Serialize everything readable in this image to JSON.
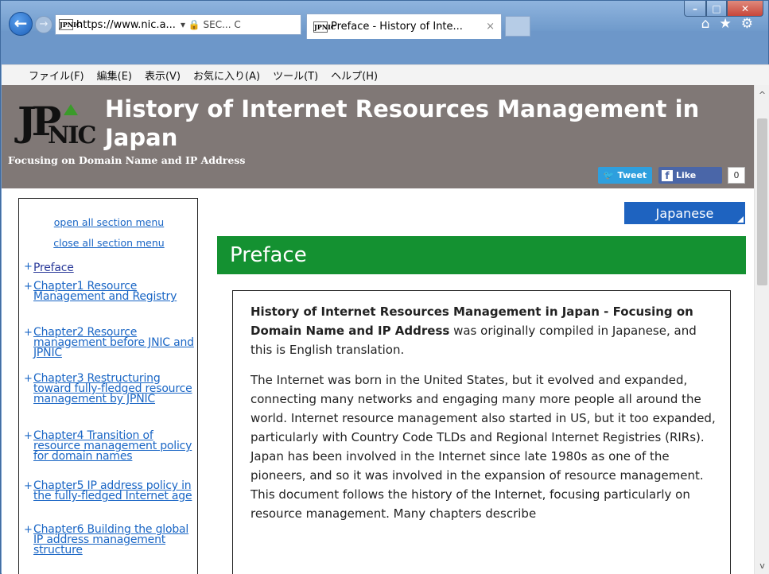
{
  "browser": {
    "window_controls": [
      "–",
      "□",
      "✕"
    ],
    "address": {
      "favicon_text": "JPNIC",
      "url": "https://www.nic.a...",
      "controls": "▾  🔒 SEC... C"
    },
    "tab": {
      "favicon_text": "JPNIC",
      "title": "Preface - History of Inte...",
      "close": "×"
    },
    "tool_icons": [
      "⌂",
      "★",
      "⚙"
    ],
    "menu": [
      "ファイル(F)",
      "編集(E)",
      "表示(V)",
      "お気に入り(A)",
      "ツール(T)",
      "ヘルプ(H)"
    ]
  },
  "banner": {
    "title": "History of Internet Resources Management in Japan",
    "subtitle": "Focusing on Domain Name and IP Address",
    "tweet_label": "Tweet",
    "like_label": "Like",
    "like_count": "0"
  },
  "sidebar": {
    "open_all": "open all section menu",
    "close_all": "close all section menu",
    "items": [
      "Preface",
      "Chapter1 Resource Management and Registry",
      "Chapter2 Resource management before JNIC and JPNIC",
      "Chapter3 Restructuring toward fully-fledged resource management by JPNIC",
      "Chapter4 Transition of resource management policy for domain names",
      "Chapter5 IP address policy in the fully-fledged Internet age",
      "Chapter6 Building the global IP address management structure"
    ]
  },
  "main": {
    "language_button": "Japanese",
    "section_title": "Preface",
    "intro_bold": "History of Internet Resources Management in Japan - Focusing on Domain Name and IP Address",
    "intro_rest": " was originally compiled in Japanese, and this is English translation.",
    "paragraph2": "The Internet was born in the United States, but it evolved and expanded, connecting many networks and engaging many more people all around the world. Internet resource management also started in US, but it too expanded, particularly with Country Code TLDs and Regional Internet Registries (RIRs). Japan has been involved in the Internet since late 1980s as one of the pioneers, and so it was involved in the expansion of resource management. This document follows the history of the Internet, focusing particularly on resource management. Many chapters describe"
  },
  "colors": {
    "banner_bg": "#807876",
    "section_green": "#149131",
    "lang_button_blue": "#1e63c0",
    "link_blue": "#1a66c5"
  }
}
